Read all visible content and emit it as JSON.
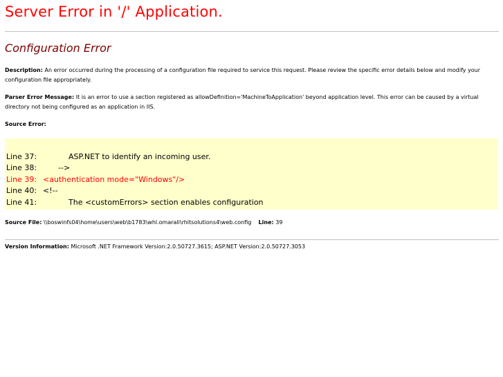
{
  "page_title": "Server Error in '/' Application.",
  "error_title": "Configuration Error",
  "description": {
    "label": "Description:",
    "text": "An error occurred during the processing of a configuration file required to service this request. Please review the specific error details below and modify your configuration file appropriately."
  },
  "parser_error": {
    "label": "Parser Error Message:",
    "text": "It is an error to use a section registered as allowDefinition='MachineToApplication' beyond application level.  This error can be caused by a virtual directory not being configured as an application in IIS."
  },
  "source_error": {
    "label": "Source Error:",
    "lines": [
      {
        "number": "Line 37:",
        "text": "ASP.NET to identify an incoming user.",
        "highlight": false
      },
      {
        "number": "Line 38:",
        "text": "-->",
        "highlight": false
      },
      {
        "number": "Line 39:",
        "text": "<authentication mode=\"Windows\"/>",
        "highlight": true
      },
      {
        "number": "Line 40:",
        "text": "<!--",
        "highlight": false
      },
      {
        "number": "Line 41:",
        "text": "The <customErrors> section enables configuration",
        "highlight": false
      }
    ]
  },
  "source_file": {
    "label": "Source File:",
    "path": "\\\\boswinfs04\\home\\users\\web\\b1783\\whl.omarali\\rhitsolutions4\\web.config",
    "line_label": "Line:",
    "line_value": "39"
  },
  "version_info": {
    "label": "Version Information:",
    "text": "Microsoft .NET Framework Version:2.0.50727.3615; ASP.NET Version:2.0.50727.3053"
  },
  "colors": {
    "title": "#ff0000",
    "subtitle": "#800000",
    "code_background": "#ffffcc",
    "highlight_line": "#ff0000",
    "rule": "#c0c0c0"
  }
}
